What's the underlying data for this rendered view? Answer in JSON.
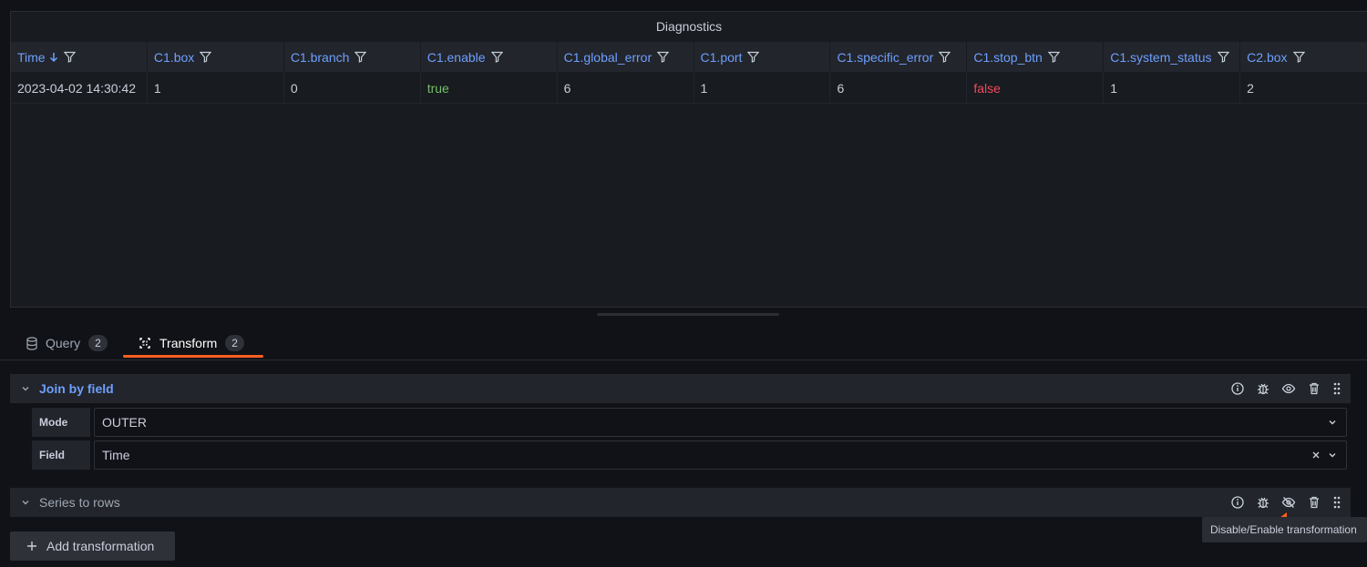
{
  "panel": {
    "title": "Diagnostics",
    "columns": [
      {
        "label": "Time",
        "sorted": "desc"
      },
      {
        "label": "C1.box"
      },
      {
        "label": "C1.branch"
      },
      {
        "label": "C1.enable"
      },
      {
        "label": "C1.global_error"
      },
      {
        "label": "C1.port"
      },
      {
        "label": "C1.specific_error"
      },
      {
        "label": "C1.stop_btn"
      },
      {
        "label": "C1.system_status"
      },
      {
        "label": "C2.box"
      }
    ],
    "rows": [
      [
        "2023-04-02 14:30:42",
        "1",
        "0",
        "true",
        "6",
        "1",
        "6",
        "false",
        "1",
        "2"
      ]
    ]
  },
  "tabs": [
    {
      "label": "Query",
      "count": "2",
      "icon": "database-icon"
    },
    {
      "label": "Transform",
      "count": "2",
      "icon": "transform-icon"
    }
  ],
  "transformations": [
    {
      "name": "Join by field",
      "fields": [
        {
          "label": "Mode",
          "value": "OUTER"
        },
        {
          "label": "Field",
          "value": "Time"
        }
      ]
    },
    {
      "name": "Series to rows"
    }
  ],
  "add_button": "Add transformation",
  "tooltip": "Disable/Enable transformation",
  "colors": {
    "accent": "#ff5f1f",
    "link": "#6e9fff",
    "true": "#73bf69",
    "false": "#f2495c"
  }
}
